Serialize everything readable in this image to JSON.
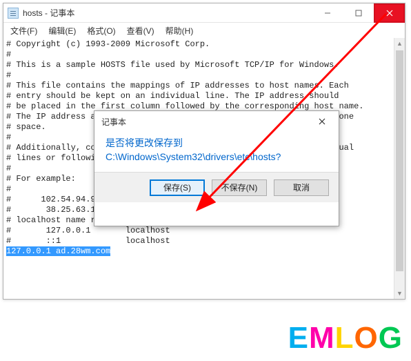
{
  "window": {
    "title": "hosts - 记事本"
  },
  "menu": {
    "file": "文件(F)",
    "edit": "编辑(E)",
    "format": "格式(O)",
    "view": "查看(V)",
    "help": "帮助(H)"
  },
  "editor": {
    "lines": [
      "# Copyright (c) 1993-2009 Microsoft Corp.",
      "#",
      "# This is a sample HOSTS file used by Microsoft TCP/IP for Windows.",
      "#",
      "# This file contains the mappings of IP addresses to host names. Each",
      "# entry should be kept on an individual line. The IP address should",
      "# be placed in the first column followed by the corresponding host name.",
      "# The IP address and the host name should be separated by at least one",
      "# space.",
      "#",
      "# Additionally, comments (such as these) may be inserted on individual",
      "# lines or following the machine name denoted by a '#' symbol.",
      "#",
      "# For example:",
      "#",
      "#      102.54.94.97     rhino.acme.com          # source server",
      "#       38.25.63.10     x.acme.com              # x client host",
      "",
      "# localhost name resolution is handled within DNS itself.",
      "#       127.0.0.1       localhost",
      "#       ::1             localhost"
    ],
    "selected_line": "127.0.0.1 ad.28wm.com"
  },
  "dialog": {
    "title": "记事本",
    "line1": "是否将更改保存到",
    "line2": "C:\\Windows\\System32\\drivers\\etc\\hosts?",
    "save": "保存(S)",
    "dontsave": "不保存(N)",
    "cancel": "取消"
  },
  "watermark": {
    "t1": "E",
    "t2": "M",
    "t3": "L",
    "t4": "O",
    "t5": "G"
  }
}
